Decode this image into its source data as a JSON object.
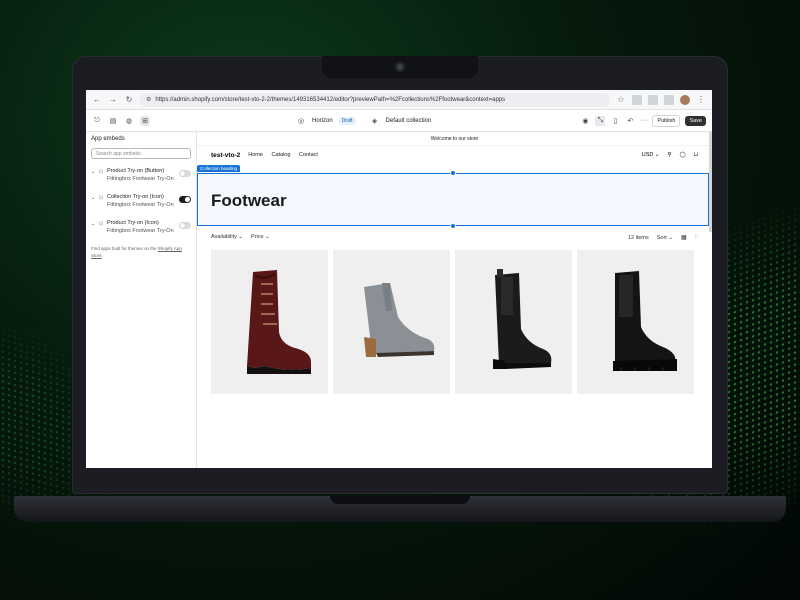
{
  "browser": {
    "url": "https://admin.shopify.com/store/test-vto-2-2/themes/149316534412/editor?previewPath=%2Fcollections%2Ffootwear&context=apps"
  },
  "editor_toolbar": {
    "theme_name": "Horizon",
    "status_badge": "Draft",
    "template": "Default collection",
    "publish_label": "Publish",
    "save_label": "Save"
  },
  "sidebar": {
    "title": "App embeds",
    "search_placeholder": "Search app embeds",
    "embeds": [
      {
        "title": "Product Try-on (Button)",
        "subtitle": "Fittingbox Footwear Try-On",
        "enabled": false
      },
      {
        "title": "Collection Try-on (Icon)",
        "subtitle": "Fittingbox Footwear Try-On",
        "enabled": true
      },
      {
        "title": "Product Try-on (Icon)",
        "subtitle": "Fittingbox Footwear Try-On",
        "enabled": false
      }
    ],
    "note_prefix": "Find apps built for themes on the ",
    "note_link": "Shopify App Store",
    "note_suffix": "."
  },
  "store": {
    "announcement": "Welcome to our store",
    "brand": "test-vto-2",
    "nav": [
      "Home",
      "Catalog",
      "Contact"
    ],
    "currency": "USD ⌄",
    "section_tag": "Collection heading",
    "heading": "Footwear",
    "filters": [
      "Availability ⌄",
      "Price ⌄"
    ],
    "item_count": "12 items",
    "sort_label": "Sort ⌄"
  },
  "products": [
    {
      "name": "Brown lace-up boot",
      "color": "#6a1e1c"
    },
    {
      "name": "Grey ankle bootie",
      "color": "#8d9096"
    },
    {
      "name": "Black chelsea boot",
      "color": "#1a1a1a"
    },
    {
      "name": "Black lug-sole chelsea boot",
      "color": "#121212"
    }
  ],
  "colors": {
    "accent": "#1773d5",
    "background": "#061a0c"
  }
}
